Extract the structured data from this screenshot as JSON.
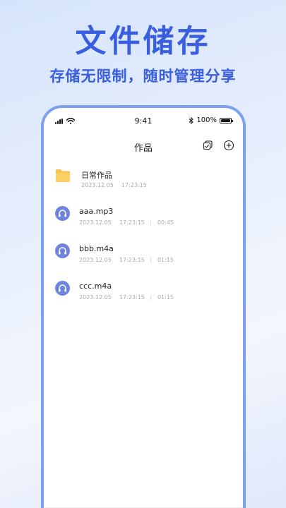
{
  "promo": {
    "headline": "文件储存",
    "subline": "存储无限制，随时管理分享"
  },
  "status_bar": {
    "time": "9:41",
    "battery": "100%"
  },
  "nav": {
    "title": "作品"
  },
  "files": [
    {
      "type": "folder",
      "name": "日常作品",
      "date": "2023.12.05",
      "time": "17:23:15",
      "duration": ""
    },
    {
      "type": "audio",
      "name": "aaa.mp3",
      "date": "2023.12.05",
      "time": "17:23:15",
      "duration": "00:45"
    },
    {
      "type": "audio",
      "name": "bbb.m4a",
      "date": "2023.12.05",
      "time": "17:23:15",
      "duration": "01:15"
    },
    {
      "type": "audio",
      "name": "ccc.m4a",
      "date": "2023.12.05",
      "time": "17:23:15",
      "duration": "01:15"
    }
  ],
  "colors": {
    "accent": "#3a5ee0",
    "phone_border": "#7f9ff0",
    "folder": "#f7c34a",
    "audio_icon": "#6f84dc"
  }
}
